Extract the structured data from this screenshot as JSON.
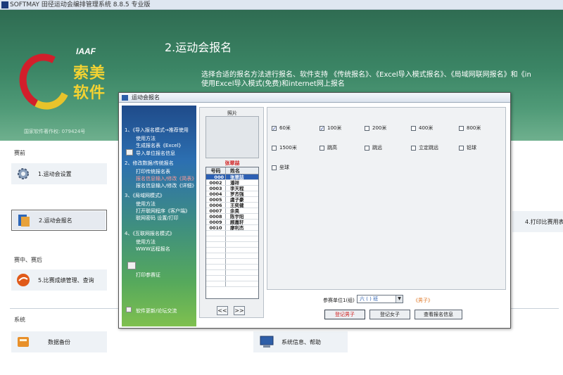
{
  "window": {
    "title": "SOFTMAY 田径运动会编排管理系统 8.8.5 专业版"
  },
  "header": {
    "logo_iaaf": "IAAF",
    "logo_brand_line1": "索美",
    "logo_brand_line2": "软件",
    "copyright": "国家软件著作权: 079424号",
    "section_title": "2.运动会报名",
    "description_line1": "选择合适的报名方法进行报名、软件支持 《传统报名》、《Excel导入模式报名》、《局域网联网报名》和《in",
    "description_line2": "使用Excel导入模式(免费)和internet网上报名"
  },
  "left_menu": {
    "group_pre": "赛前",
    "btn_setup": "1.运动会设置",
    "btn_register": "2.运动会报名",
    "group_during": "赛中、赛后",
    "btn_results": "5.比赛成绩管理、查询",
    "group_system": "系统",
    "btn_backup": "数据备份",
    "btn_sysinfo": "系统信息、帮助",
    "btn_print": "4.打印比赛用表"
  },
  "dialog": {
    "title": "运动会报名",
    "side_menu": {
      "s1_title": "1、《导入报名模式→推荐使用",
      "s1_usage": "使用方法",
      "s1_gen_excel": "生成报名表《Excel》",
      "s1_import": "导入单位报名信息",
      "s2_title": "2、修改数据/传统报名",
      "s2_print": "打印传统报名表",
      "s2_input": "报名信息输入/修改《简表》",
      "s2_input_detail": "报名信息输入/修改《详细》",
      "s3_title": "3、《局域网模式》",
      "s3_usage": "使用方法",
      "s3_open": "打开联网程序《客户端》",
      "s3_pwd": "联网密码 设置/打印",
      "s4_title": "4、《互联网报名模式》",
      "s4_usage": "使用方法",
      "s4_www": "WWW远程报名",
      "print_cert": "打印参赛证",
      "update": "软件更新/论坛交流"
    },
    "photo_label": "照片",
    "selected_name": "张翠喆",
    "roster": {
      "col_number": "号码",
      "col_name": "姓名",
      "rows": [
        {
          "number": "000",
          "name": "张翠喆"
        },
        {
          "number": "0002",
          "name": "潘祥"
        },
        {
          "number": "0003",
          "name": "李天程"
        },
        {
          "number": "0004",
          "name": "罗杰强"
        },
        {
          "number": "0005",
          "name": "虞子豪"
        },
        {
          "number": "0006",
          "name": "王奕健"
        },
        {
          "number": "0007",
          "name": "余昊"
        },
        {
          "number": "0008",
          "name": "陈宇阳"
        },
        {
          "number": "0009",
          "name": "顾嘉轩"
        },
        {
          "number": "0010",
          "name": "廖利杰"
        },
        {
          "number": "",
          "name": ""
        },
        {
          "number": "",
          "name": ""
        },
        {
          "number": "",
          "name": ""
        },
        {
          "number": "",
          "name": ""
        },
        {
          "number": "",
          "name": ""
        },
        {
          "number": "",
          "name": ""
        },
        {
          "number": "",
          "name": ""
        },
        {
          "number": "",
          "name": ""
        },
        {
          "number": "",
          "name": ""
        },
        {
          "number": "",
          "name": ""
        }
      ]
    },
    "pager_prev": "<<",
    "pager_next": ">>",
    "events": [
      {
        "name": "60米",
        "checked": true
      },
      {
        "name": "100米",
        "checked": true
      },
      {
        "name": "200米",
        "checked": false
      },
      {
        "name": "400米",
        "checked": false
      },
      {
        "name": "800米",
        "checked": false
      },
      {
        "name": "1500米",
        "checked": false
      },
      {
        "name": "跳高",
        "checked": false
      },
      {
        "name": "跳远",
        "checked": false
      },
      {
        "name": "立定跳远",
        "checked": false
      },
      {
        "name": "铅球",
        "checked": false
      },
      {
        "name": "垒球",
        "checked": false
      }
    ],
    "unit_label": "参赛单位1(组)",
    "unit_value": "六 ( ) 班",
    "gender_label": "《男子》",
    "btn_male": "登记男子",
    "btn_female": "登记女子",
    "btn_view": "查看报名信息"
  }
}
